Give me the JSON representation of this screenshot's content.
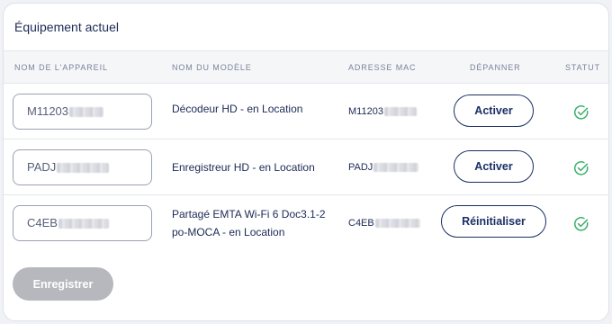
{
  "section": {
    "title": "Équipement actuel"
  },
  "table": {
    "headers": {
      "device_name": "NOM DE L'APPAREIL",
      "model_name": "NOM DU MODÈLE",
      "mac_address": "ADRESSE MAC",
      "troubleshoot": "DÉPANNER",
      "status": "STATUT"
    },
    "rows": [
      {
        "device_prefix": "M11203",
        "model_line1": "Décodeur HD - en Location",
        "model_line2": "",
        "mac_prefix": "M11203",
        "action_label": "Activer",
        "status": "ok"
      },
      {
        "device_prefix": "PADJ",
        "model_line1": "Enregistreur HD - en Location",
        "model_line2": "",
        "mac_prefix": "PADJ",
        "action_label": "Activer",
        "status": "ok"
      },
      {
        "device_prefix": "C4EB",
        "model_line1": "Partagé EMTA Wi-Fi 6 Doc3.1-2",
        "model_line2": "po-MOCA - en Location",
        "mac_prefix": "C4EB",
        "action_label": "Réinitialiser",
        "status": "ok"
      }
    ]
  },
  "footer": {
    "save_label": "Enregistrer"
  },
  "colors": {
    "navy": "#1a2f63",
    "status_green": "#3db06a",
    "disabled_button": "#b6b8bd"
  },
  "icons": {
    "status": "check-circle-icon"
  }
}
